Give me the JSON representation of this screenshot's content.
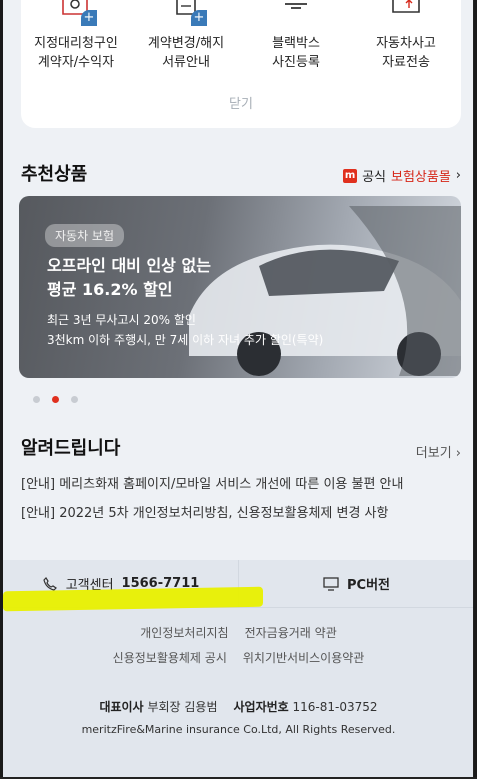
{
  "menu": {
    "items": [
      {
        "label_line1": "지정대리청구인",
        "label_line2": "계약자/수익자",
        "icon": "person-icon"
      },
      {
        "label_line1": "계약변경/해지",
        "label_line2": "서류안내",
        "icon": "document-icon"
      },
      {
        "label_line1": "블랙박스",
        "label_line2": "사진등록",
        "icon": "blackbox-icon"
      },
      {
        "label_line1": "자동차사고",
        "label_line2": "자료전송",
        "icon": "upload-icon"
      }
    ],
    "close_label": "닫기"
  },
  "recommend": {
    "title": "추천상품",
    "shop_prefix": "공식",
    "shop_highlight": "보험상품몰",
    "shop_arrow": "›",
    "badge": "m",
    "banner": {
      "tag": "자동차 보험",
      "headline_line1": "오프라인 대비 인상 없는",
      "headline_line2": "평균 16.2% 할인",
      "sub_line1": "최근 3년 무사고시 20% 할인",
      "sub_line2": "3천km 이하 주행시, 만 7세 이하 자녀 추가 할인(특약)"
    },
    "active_dot": 1
  },
  "notice": {
    "title": "알려드립니다",
    "more_label": "더보기 ›",
    "items": [
      "[안내] 메리츠화재 홈페이지/모바일 서비스 개선에 따른 이용 불편 안내",
      "[안내] 2022년 5차 개인정보처리방침, 신용정보활용체제 변경 사항"
    ]
  },
  "footer": {
    "call_label": "고객센터",
    "call_number": "1566-7711",
    "pc_label": "PC버전",
    "links_row1": [
      "개인정보처리지침",
      "전자금융거래 약관"
    ],
    "links_row2": [
      "신용정보활용체제 공시",
      "위치기반서비스이용약관"
    ],
    "ceo_label": "대표이사",
    "ceo_value": "부회장 김용범",
    "biz_label": "사업자번호",
    "biz_value": "116-81-03752",
    "copyright": "meritzFire&Marine insurance Co.Ltd, All Rights Reserved."
  },
  "colors": {
    "accent": "#e0301e",
    "blue": "#3a7ab8",
    "highlight": "#e8f000"
  }
}
